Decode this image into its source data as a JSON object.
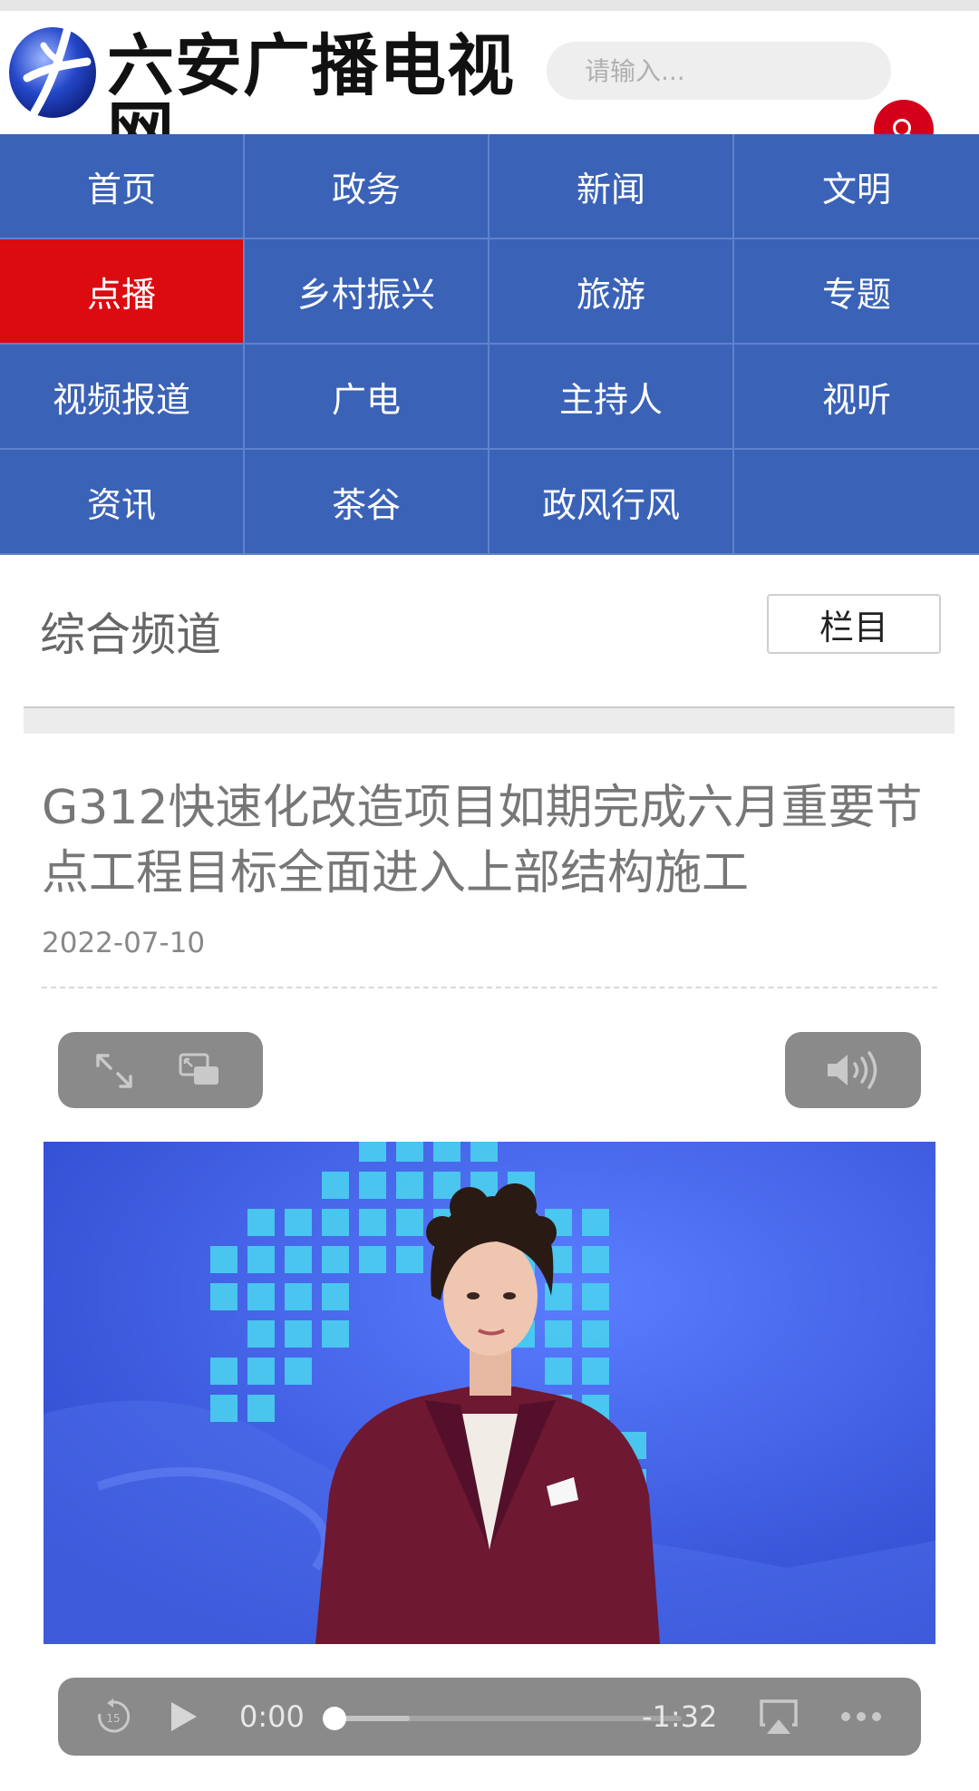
{
  "header": {
    "logo_text": "六安广播电视网",
    "search_placeholder": "请输入..."
  },
  "nav": {
    "items": [
      {
        "label": "首页"
      },
      {
        "label": "政务"
      },
      {
        "label": "新闻"
      },
      {
        "label": "文明"
      },
      {
        "label": "点播",
        "active": true
      },
      {
        "label": "乡村振兴"
      },
      {
        "label": "旅游"
      },
      {
        "label": "专题"
      },
      {
        "label": "视频报道"
      },
      {
        "label": "广电"
      },
      {
        "label": "主持人"
      },
      {
        "label": "视听"
      },
      {
        "label": "资讯"
      },
      {
        "label": "茶谷"
      },
      {
        "label": "政风行风"
      }
    ],
    "active_color": "#db0b10",
    "background_color": "#3a62b7"
  },
  "channel": {
    "title": "综合频道",
    "column_button": "栏目"
  },
  "article": {
    "title": "G312快速化改造项目如期完成六月重要节点工程目标全面进入上部结构施工",
    "date": "2022-07-10"
  },
  "player": {
    "current_time": "0:00",
    "remaining_time": "-1:32",
    "progress": 0.0,
    "skip_back_seconds": "15"
  }
}
